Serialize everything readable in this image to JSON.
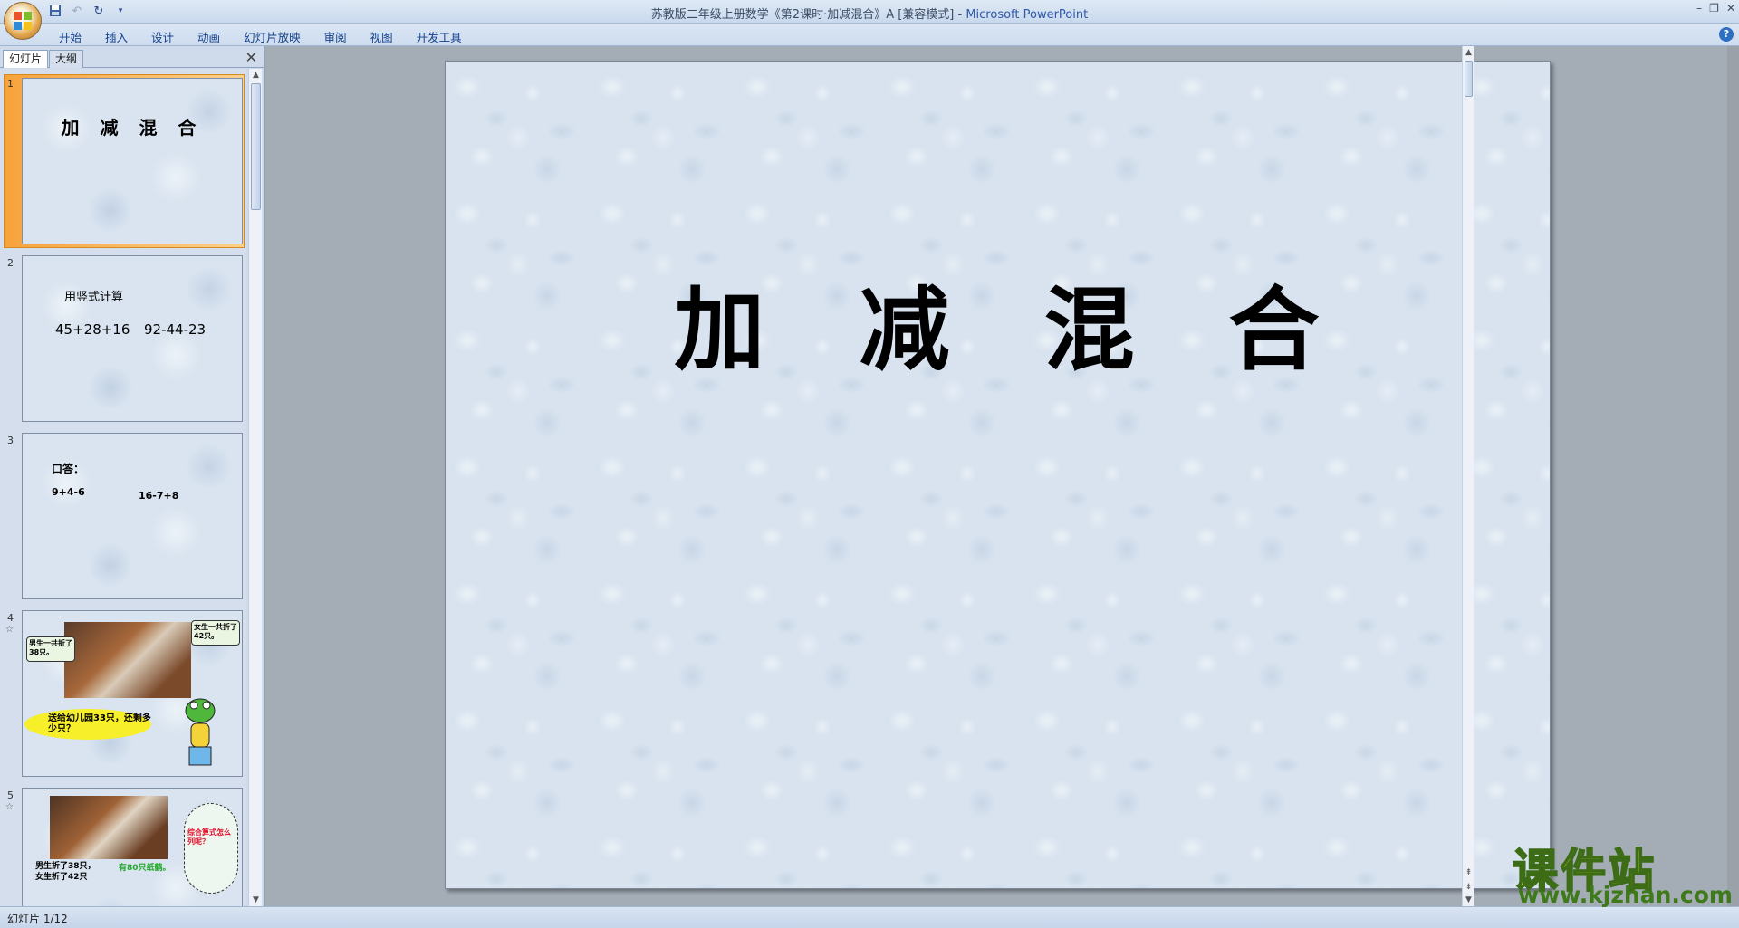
{
  "window": {
    "title": "苏教版二年级上册数学《第2课时·加减混合》A [兼容模式] - ",
    "app_name": "Microsoft PowerPoint",
    "controls": [
      "–",
      "❐",
      "✕"
    ]
  },
  "ribbon": {
    "tabs": [
      "开始",
      "插入",
      "设计",
      "动画",
      "幻灯片放映",
      "审阅",
      "视图",
      "开发工具"
    ]
  },
  "panel": {
    "tab_slides": "幻灯片",
    "tab_outline": "大纲",
    "close": "✕"
  },
  "thumbnails": [
    {
      "num": "1",
      "title": "加 减 混 合"
    },
    {
      "num": "2",
      "heading": "用竖式计算",
      "expr1": "45+28+16",
      "expr2": "92-44-23"
    },
    {
      "num": "3",
      "heading": "口答：",
      "expr1": "9+4-6",
      "expr2": "16-7+8"
    },
    {
      "num": "4",
      "star": "☆",
      "bubble_left": "男生一共折了38只。",
      "bubble_right": "女生一共折了42只。",
      "question": "送给幼儿园33只，还剩多少只？"
    },
    {
      "num": "5",
      "star": "☆",
      "text1": "男生折了38只，",
      "text2": "女生折了42只",
      "text3": "有80只纸鹤。",
      "cloud": "综合算式怎么列呢？"
    }
  ],
  "slide": {
    "title": "加　减　混　合"
  },
  "status": {
    "text": "幻灯片 1/12"
  },
  "watermark": {
    "main": "课件站",
    "url": "www.kjzhan.com"
  }
}
